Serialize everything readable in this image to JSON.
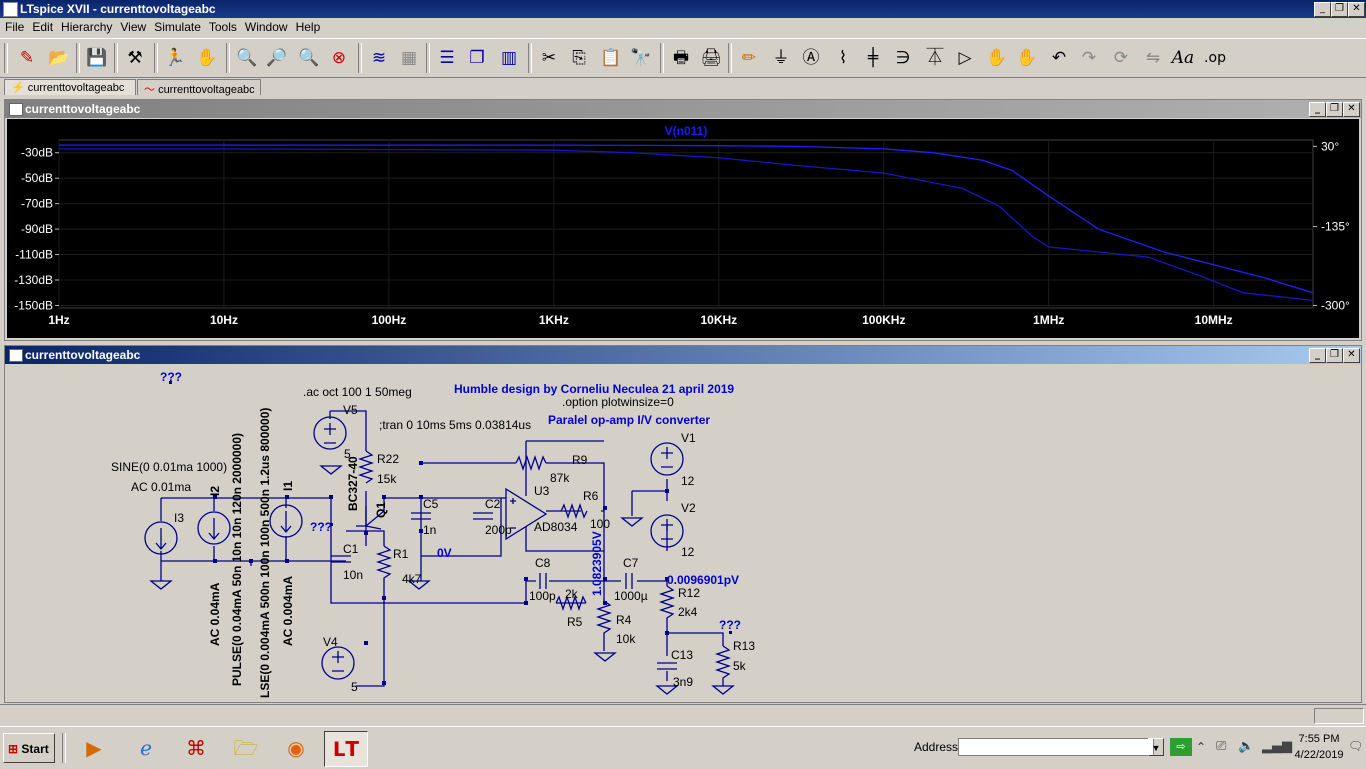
{
  "app": {
    "title": "LTspice XVII - currenttovoltageabc"
  },
  "menu": [
    "File",
    "Edit",
    "Hierarchy",
    "View",
    "Simulate",
    "Tools",
    "Window",
    "Help"
  ],
  "toolbar_icons": [
    "new-schematic-icon",
    "open-icon",
    "save-icon",
    "control-panel-icon",
    "run-icon",
    "halt-icon",
    "zoom-in-icon",
    "zoom-pan-icon",
    "zoom-out-icon",
    "zoom-fit-icon",
    "autorange-icon",
    "grid-icon",
    "tile-horizontal-icon",
    "cascade-icon",
    "tile-vertical-icon",
    "cut-icon",
    "copy-icon",
    "paste-icon",
    "find-icon",
    "print-setup-icon",
    "print-icon",
    "draw-wire-icon",
    "ground-icon",
    "label-net-icon",
    "resistor-icon",
    "capacitor-icon",
    "inductor-icon",
    "diode-icon",
    "component-icon",
    "move-icon",
    "drag-icon",
    "undo-icon",
    "redo-icon",
    "rotate-icon",
    "mirror-icon",
    "text-icon",
    "spice-directive-icon"
  ],
  "tabs": [
    "currenttovoltageabc",
    "currenttovoltageabc"
  ],
  "plot_window": {
    "title": "currenttovoltageabc"
  },
  "schematic_window": {
    "title": "currenttovoltageabc"
  },
  "chart_data": {
    "type": "line",
    "title": "V(n011)",
    "x_scale": "log",
    "x_ticks": [
      "1Hz",
      "10Hz",
      "100Hz",
      "1KHz",
      "10KHz",
      "100KHz",
      "1MHz",
      "10MHz"
    ],
    "y_ticks_left": [
      "-30dB",
      "-50dB",
      "-70dB",
      "-90dB",
      "-110dB",
      "-130dB",
      "-150dB"
    ],
    "y_ticks_right": [
      "30°",
      "-135°",
      "-300°"
    ],
    "xlim": [
      1,
      40000000
    ],
    "ylim": [
      -152,
      -20
    ],
    "series": [
      {
        "name": "magnitude",
        "x": [
          1,
          10,
          100,
          1000,
          10000,
          30000,
          100000,
          200000,
          400000,
          600000,
          1000000,
          2000000,
          5000000,
          10000000,
          20000000,
          40000000
        ],
        "y": [
          -24,
          -24,
          -24,
          -24,
          -24.5,
          -25,
          -27,
          -30,
          -36,
          -44,
          -64,
          -90,
          -108,
          -118,
          -128,
          -140
        ]
      },
      {
        "name": "phase",
        "x": [
          1,
          10,
          100,
          1000,
          3000,
          10000,
          30000,
          100000,
          300000,
          500000,
          800000,
          1000000,
          2000000,
          4000000,
          8000000,
          15000000,
          40000000
        ],
        "y": [
          -27,
          -27,
          -27.5,
          -28,
          -30,
          -34,
          -40,
          -46,
          -58,
          -72,
          -96,
          -104,
          -108,
          -112,
          -126,
          -140,
          -146
        ]
      }
    ]
  },
  "schematic": {
    "directive_ac": ".ac oct 100 1 50meg",
    "directive_tran": ";tran 0 10ms 5ms 0.03814us",
    "directive_option": ".option plotwinsize=0",
    "comment_design": "Humble design by Corneliu Neculea 21 april 2019",
    "comment_converter": "Paralel op-amp I/V converter",
    "unknown_marks": [
      "???",
      "???",
      "???"
    ],
    "i3_value": "SINE(0 0.01ma 1000)",
    "i3_ac": "AC 0.01ma",
    "i3_name": "I3",
    "i2_name": "I2",
    "i2_pulse": "PULSE(0 0.04mA 50n 10n 10n 120n 2000000)",
    "i2_ac": "AC 0.04mA",
    "i1_name": "I1",
    "i1_pulse": "LSE(0 0.004mA 500n 100n 100n 500n 1.2us 800000)",
    "i1_ac": "AC 0.004mA",
    "v5": {
      "name": "V5",
      "value": "5"
    },
    "v4": {
      "name": "V4",
      "value": "5"
    },
    "v1": {
      "name": "V1",
      "value": "12"
    },
    "v2": {
      "name": "V2",
      "value": "12"
    },
    "r22": {
      "name": "R22",
      "value": "15k"
    },
    "q1": {
      "name": "Q1",
      "model": "BC327-40"
    },
    "c1": {
      "name": "C1",
      "value": "10n"
    },
    "r1": {
      "name": "R1",
      "value": "4k7"
    },
    "c5": {
      "name": "C5",
      "value": "1n"
    },
    "c2": {
      "name": "C2",
      "value": "200p"
    },
    "r9": {
      "name": "R9",
      "value": "87k"
    },
    "u3": {
      "name": "U3",
      "model": "AD8034"
    },
    "r6": {
      "name": "R6",
      "value": "100"
    },
    "c8": {
      "name": "C8",
      "value": "100p"
    },
    "r5": {
      "name": "R5",
      "value": "2k"
    },
    "r4": {
      "name": "R4",
      "value": "10k"
    },
    "c7": {
      "name": "C7",
      "value": "1000µ"
    },
    "r12": {
      "name": "R12",
      "value": "2k4"
    },
    "c13": {
      "name": "C13",
      "value": "3n9"
    },
    "r13": {
      "name": "R13",
      "value": "5k"
    },
    "op_v_node": "1.0823905V",
    "op_zero": "0V",
    "op_pv": "0.0096901pV"
  },
  "taskbar": {
    "start": "Start",
    "address_label": "Address",
    "address_value": "",
    "clock_time": "7:55 PM",
    "clock_date": "4/22/2019",
    "apps": [
      "media-player-icon",
      "internet-explorer-icon",
      "pdf-reader-icon",
      "file-explorer-icon",
      "firefox-icon",
      "ltspice-icon"
    ]
  },
  "colors": {
    "plot_bg": "#000000",
    "trace": "#1a1aff",
    "grid": "#202020",
    "title_active": "#0a246a",
    "title_inactive": "#808080",
    "schematic_bg": "#d4d0c8",
    "schematic_blue": "#0000cc"
  }
}
